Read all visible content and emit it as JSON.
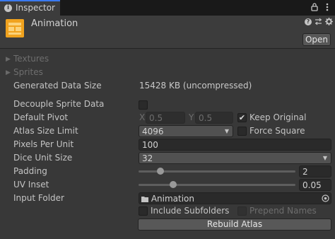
{
  "tab": {
    "label": "Inspector",
    "info_glyph": "i"
  },
  "header": {
    "title": "Animation",
    "help_glyph": "?",
    "open_label": "Open"
  },
  "sections": {
    "textures_label": "Textures",
    "sprites_label": "Sprites"
  },
  "fields": {
    "generated_data_size": {
      "label": "Generated Data Size",
      "value": "15428 KB (uncompressed)"
    },
    "decouple_sprite_data": {
      "label": "Decouple Sprite Data",
      "checked": false
    },
    "default_pivot": {
      "label": "Default Pivot",
      "x_label": "X",
      "x_value": "0.5",
      "y_label": "Y",
      "y_value": "0.5",
      "keep_original_label": "Keep Original",
      "keep_original_checked": true
    },
    "atlas_size_limit": {
      "label": "Atlas Size Limit",
      "value": "4096",
      "force_square_label": "Force Square",
      "force_square_checked": false
    },
    "pixels_per_unit": {
      "label": "Pixels Per Unit",
      "value": "100"
    },
    "dice_unit_size": {
      "label": "Dice Unit Size",
      "value": "32"
    },
    "padding": {
      "label": "Padding",
      "value": "2",
      "slider_fraction": 0.14
    },
    "uv_inset": {
      "label": "UV Inset",
      "value": "0.05",
      "slider_fraction": 0.22
    },
    "input_folder": {
      "label": "Input Folder",
      "value": "Animation",
      "include_subfolders_label": "Include Subfolders",
      "include_subfolders_checked": false,
      "prepend_names_label": "Prepend Names",
      "prepend_names_checked": false
    }
  },
  "rebuild_label": "Rebuild Atlas",
  "colors": {
    "background": "#383838",
    "tab_accent": "#3a7af0",
    "asset_icon": "#f0a21e"
  }
}
